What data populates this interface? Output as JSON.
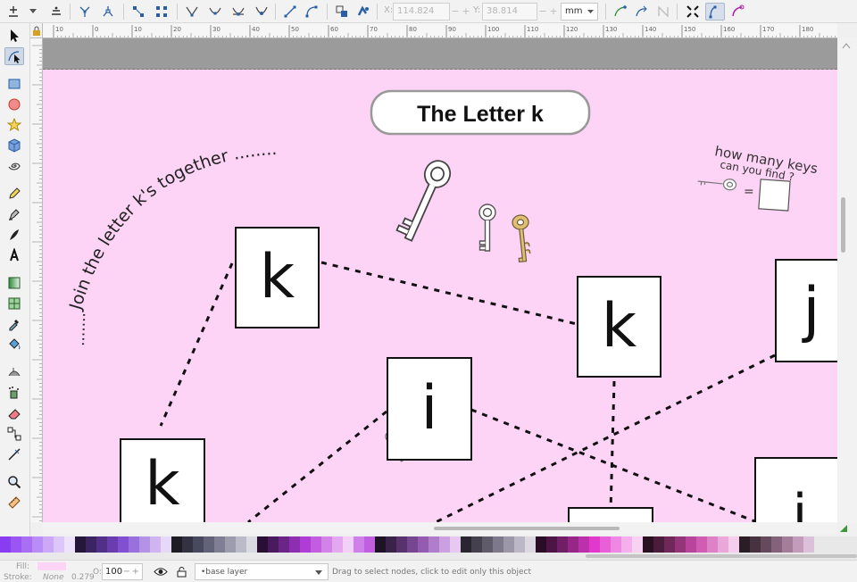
{
  "toolbar": {
    "x_label": "X:",
    "x_value": "114.824",
    "y_label": "Y:",
    "y_value": "38.814",
    "unit": "mm",
    "spin_minus": "−",
    "spin_plus": "+"
  },
  "ruler": {
    "top_ticks": [
      "10",
      "0",
      "10",
      "20",
      "30",
      "40",
      "50",
      "60",
      "70",
      "80",
      "90",
      "100",
      "110",
      "120",
      "130",
      "140",
      "150",
      "160",
      "170",
      "180"
    ]
  },
  "worksheet": {
    "title": "The Letter k",
    "instruction": "Join the letter k's together ..........",
    "question_line1": "how many keys",
    "question_line2": "can you find ?",
    "equals": "=",
    "cards": [
      {
        "letter": "k"
      },
      {
        "letter": "k"
      },
      {
        "letter": "j"
      },
      {
        "letter": "i"
      },
      {
        "letter": "k"
      },
      {
        "letter": "i"
      },
      {
        "letter": ""
      }
    ]
  },
  "statusbar": {
    "fill_label": "Fill:",
    "stroke_label": "Stroke:",
    "stroke_value": "None",
    "stroke_width": "0.279",
    "opacity_label": "O:",
    "opacity_value": "100",
    "layer_name": "•base layer",
    "message": "Drag to select nodes, click to edit only this object"
  },
  "colors": {
    "canvas_bg": "#fdd3f6",
    "desk_gray": "#9b9b9b",
    "title_border": "#999999",
    "key_gold": "#e0c070"
  },
  "palette": [
    "#8a3cf0",
    "#9a55f2",
    "#a86ff4",
    "#b98cf6",
    "#cba8f8",
    "#ddc6fa",
    "#eee2fc",
    "#25173a",
    "#3c2361",
    "#533087",
    "#6a3dae",
    "#8150d2",
    "#9a70dc",
    "#b492e6",
    "#cfb4f0",
    "#e8d8f8",
    "#1c1c22",
    "#323240",
    "#48485e",
    "#626279",
    "#7e7e94",
    "#9c9cad",
    "#babac8",
    "#dadae2",
    "#2a0f35",
    "#4a1a5e",
    "#6b2487",
    "#8d2fb0",
    "#b03cd6",
    "#c25de0",
    "#d382e8",
    "#e4a8f0",
    "#f2d0f8",
    "#d080ea",
    "#c060e0",
    "#1d1226",
    "#3a2248",
    "#58326c",
    "#774690",
    "#945cb0",
    "#b07ccc",
    "#cca0e0",
    "#e6c8f0",
    "#2a2630",
    "#44404d",
    "#605b6b",
    "#7d788a",
    "#9c97a8",
    "#bbb7c6",
    "#dbd8e2",
    "#2b0c26",
    "#4d1545",
    "#701e65",
    "#962788",
    "#bd30ab",
    "#e039cc",
    "#e860d8",
    "#ee88e2",
    "#f4b0ec",
    "#f8d2f3",
    "#2b1022",
    "#4c1c3c",
    "#6f2859",
    "#94357a",
    "#b9449c",
    "#d05cb4",
    "#de82c8",
    "#eaa8da",
    "#f4ceec",
    "#2a1d25",
    "#473240",
    "#65495c",
    "#84627a",
    "#a47d9a",
    "#c29cba",
    "#dcbfd8"
  ],
  "palette_widths": [
    12,
    12,
    12,
    12,
    12,
    12,
    12,
    12,
    12,
    12,
    12,
    12,
    12,
    12,
    12,
    12,
    12,
    12,
    12,
    12,
    12,
    12,
    12,
    12,
    12,
    12,
    12,
    12,
    12,
    12,
    12,
    12,
    12,
    12,
    12,
    12,
    12,
    12,
    12,
    12,
    12,
    12,
    12,
    12,
    12,
    12,
    12,
    12,
    12,
    12,
    12,
    12,
    12,
    12,
    12,
    12,
    12,
    12,
    12,
    12,
    12,
    12,
    12,
    12,
    12,
    12,
    12,
    12,
    12,
    12,
    12,
    12,
    12,
    12,
    12,
    12,
    12,
    12,
    12
  ]
}
